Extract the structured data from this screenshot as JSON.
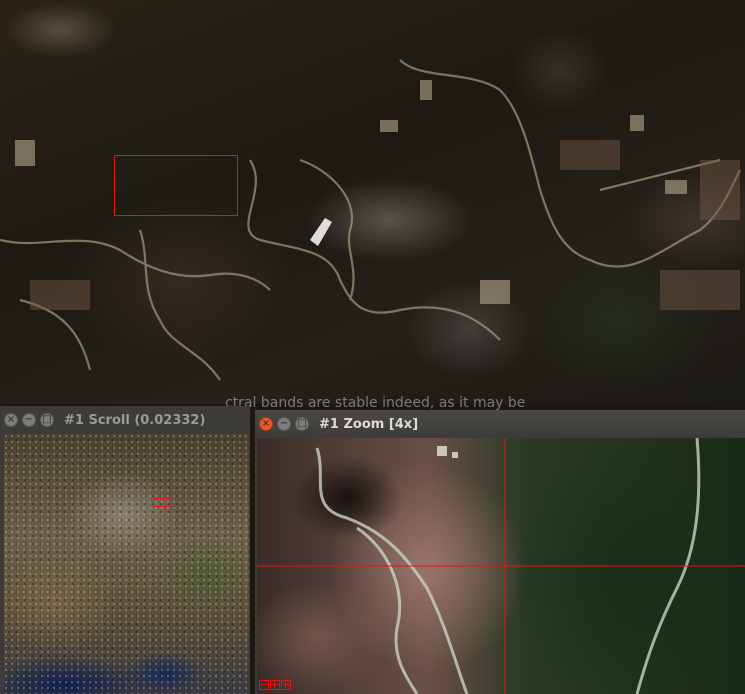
{
  "scroll_window": {
    "title": "#1 Scroll (0.02332)"
  },
  "zoom_window": {
    "title": "#1 Zoom [4x]"
  },
  "background_text": "ctral bands are stable indeed, as it may be",
  "icons": {
    "close": "close-icon",
    "minimize": "minimize-icon",
    "maximize": "maximize-icon",
    "zoom_out": "zoom-out-icon",
    "zoom_in": "zoom-in-icon"
  },
  "colors": {
    "selection": "#e01515",
    "titlebar": "#3c3b37",
    "close_button": "#e45b2c"
  }
}
